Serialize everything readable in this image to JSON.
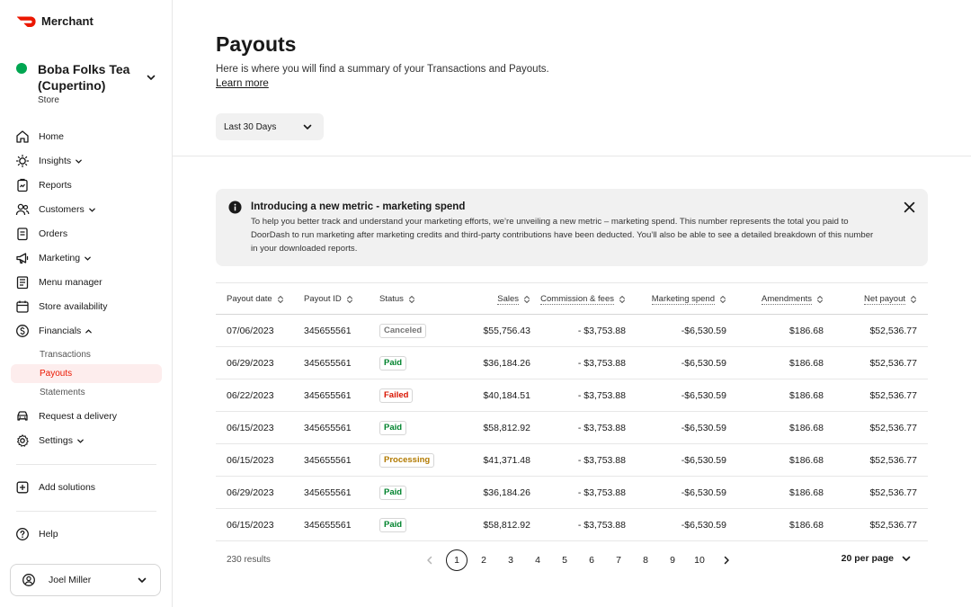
{
  "app": {
    "brand": "Merchant",
    "accent": "#eb1700"
  },
  "store": {
    "name": "Boba Folks Tea (Cupertino)",
    "type": "Store",
    "status_color": "#00a651"
  },
  "sidebar": {
    "items": [
      {
        "label": "Home",
        "icon": "home-icon"
      },
      {
        "label": "Insights",
        "icon": "lightbulb-icon"
      },
      {
        "label": "Reports",
        "icon": "clipboard-icon"
      },
      {
        "label": "Customers",
        "icon": "users-icon"
      },
      {
        "label": "Orders",
        "icon": "receipt-icon"
      },
      {
        "label": "Marketing",
        "icon": "megaphone-icon"
      },
      {
        "label": "Menu manager",
        "icon": "menu-book-icon"
      },
      {
        "label": "Store availability",
        "icon": "calendar-icon"
      },
      {
        "label": "Financials",
        "icon": "dollar-icon"
      }
    ],
    "financials_sub": [
      "Transactions",
      "Payouts",
      "Statements"
    ],
    "more": [
      {
        "label": "Request a delivery",
        "icon": "car-icon"
      },
      {
        "label": "Settings",
        "icon": "gear-icon"
      }
    ],
    "add_solutions": "Add solutions",
    "help": "Help",
    "user": "Joel Miller"
  },
  "page": {
    "title": "Payouts",
    "subtitle": "Here is where you will find a summary of your Transactions and Payouts.",
    "learn_more": "Learn more",
    "date_range": "Last 30 Days"
  },
  "banner": {
    "title": "Introducing a new metric - marketing spend",
    "body": "To help you better track and understand your marketing efforts, we’re unveiling a new metric – marketing spend. This number represents the total you paid to DoorDash to run marketing after marketing credits and third-party contributions have been deducted. You’ll also be able to see a detailed breakdown of this number in your downloaded reports."
  },
  "table": {
    "headers": [
      "Payout date",
      "Payout ID",
      "Status",
      "Sales",
      "Commission & fees",
      "Marketing spend",
      "Amendments",
      "Net payout"
    ],
    "rows": [
      {
        "date": "07/06/2023",
        "id": "345655561",
        "status": "Canceled",
        "sales": "$55,756.43",
        "commission": "- $3,753.88",
        "marketing": "-$6,530.59",
        "amend": "$186.68",
        "net": "$52,536.77"
      },
      {
        "date": "06/29/2023",
        "id": "345655561",
        "status": "Paid",
        "sales": "$36,184.26",
        "commission": "- $3,753.88",
        "marketing": "-$6,530.59",
        "amend": "$186.68",
        "net": "$52,536.77"
      },
      {
        "date": "06/22/2023",
        "id": "345655561",
        "status": "Failed",
        "sales": "$40,184.51",
        "commission": "- $3,753.88",
        "marketing": "-$6,530.59",
        "amend": "$186.68",
        "net": "$52,536.77"
      },
      {
        "date": "06/15/2023",
        "id": "345655561",
        "status": "Paid",
        "sales": "$58,812.92",
        "commission": "- $3,753.88",
        "marketing": "-$6,530.59",
        "amend": "$186.68",
        "net": "$52,536.77"
      },
      {
        "date": "06/15/2023",
        "id": "345655561",
        "status": "Processing",
        "sales": "$41,371.48",
        "commission": "- $3,753.88",
        "marketing": "-$6,530.59",
        "amend": "$186.68",
        "net": "$52,536.77"
      },
      {
        "date": "06/29/2023",
        "id": "345655561",
        "status": "Paid",
        "sales": "$36,184.26",
        "commission": "- $3,753.88",
        "marketing": "-$6,530.59",
        "amend": "$186.68",
        "net": "$52,536.77"
      },
      {
        "date": "06/15/2023",
        "id": "345655561",
        "status": "Paid",
        "sales": "$58,812.92",
        "commission": "- $3,753.88",
        "marketing": "-$6,530.59",
        "amend": "$186.68",
        "net": "$52,536.77"
      }
    ],
    "status_colors": {
      "Canceled": "#767676",
      "Paid": "#00832d",
      "Failed": "#d91400",
      "Processing": "#b27a00"
    }
  },
  "pagination": {
    "results": "230 results",
    "pages": [
      "1",
      "2",
      "3",
      "4",
      "5",
      "6",
      "7",
      "8",
      "9",
      "10"
    ],
    "current": "1",
    "per_page": "20 per page"
  }
}
